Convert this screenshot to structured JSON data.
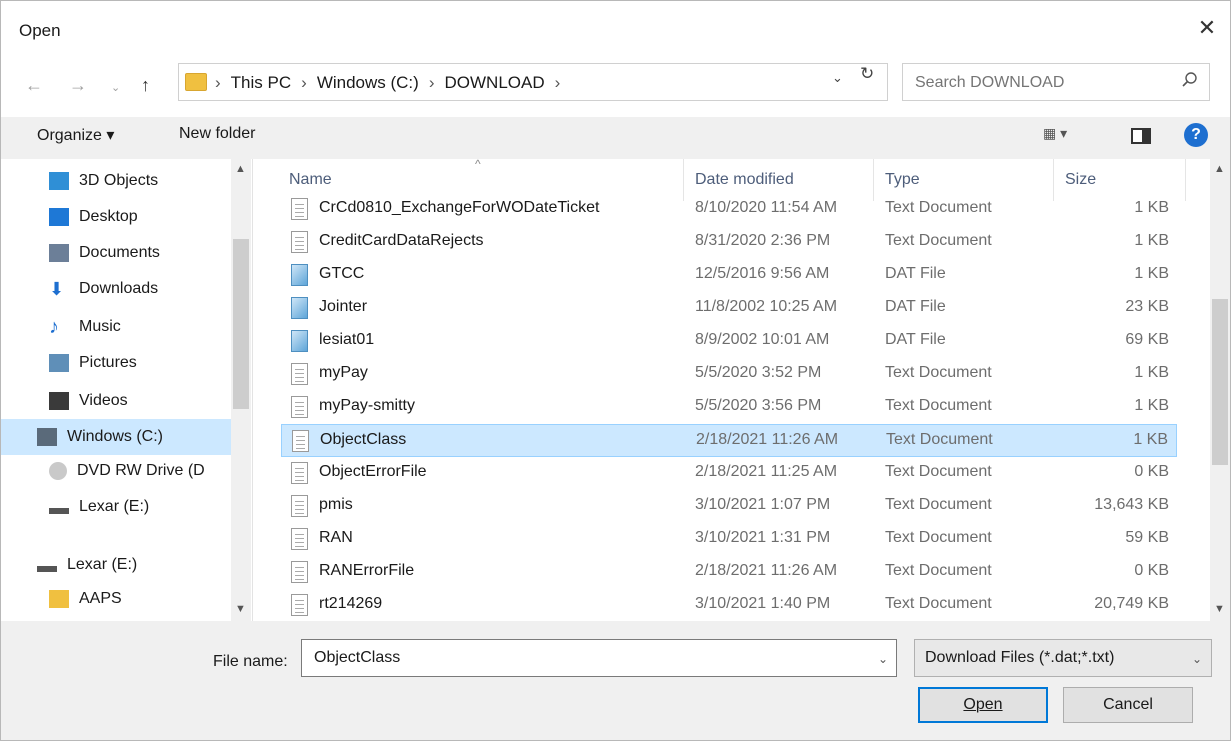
{
  "window": {
    "title": "Open",
    "close_icon": "close-icon"
  },
  "nav": {
    "back_icon": "back-arrow-icon",
    "forward_icon": "forward-arrow-icon",
    "recent_icon": "recent-locations-chevron-icon",
    "up_icon": "up-arrow-icon"
  },
  "address": {
    "breadcrumbs": [
      "This PC",
      "Windows (C:)",
      "DOWNLOAD"
    ],
    "separator": "›"
  },
  "search": {
    "placeholder": "Search DOWNLOAD"
  },
  "toolbar": {
    "organize_label": "Organize ▾",
    "new_folder_label": "New folder",
    "view_label": "▦ ▾",
    "help_label": "?"
  },
  "sidebar": {
    "items": [
      {
        "label": "3D Objects",
        "icon": "cube-3d-icon",
        "color": "#2f8fd6"
      },
      {
        "label": "Desktop",
        "icon": "desktop-icon",
        "color": "#1e78d6"
      },
      {
        "label": "Documents",
        "icon": "documents-icon",
        "color": "#6c7f98"
      },
      {
        "label": "Downloads",
        "icon": "download-arrow-icon",
        "color": "#1e6fd0"
      },
      {
        "label": "Music",
        "icon": "music-note-icon",
        "color": "#1e6fd0"
      },
      {
        "label": "Pictures",
        "icon": "pictures-icon",
        "color": "#5f8fb8"
      },
      {
        "label": "Videos",
        "icon": "videos-icon",
        "color": "#3a3a3a"
      },
      {
        "label": "Windows (C:)",
        "icon": "drive-icon",
        "color": "#5a6a7a",
        "selected": true
      },
      {
        "label": "DVD RW Drive (D",
        "icon": "dvd-drive-icon",
        "color": "#c9c9c9"
      },
      {
        "label": "Lexar (E:)",
        "icon": "usb-drive-icon",
        "color": "#555555"
      },
      {
        "label": "Lexar (E:)",
        "icon": "usb-drive-icon",
        "color": "#555555"
      },
      {
        "label": "AAPS",
        "icon": "folder-icon",
        "color": "#f0c040"
      }
    ]
  },
  "files": {
    "columns": [
      "Name",
      "Date modified",
      "Type",
      "Size"
    ],
    "rows": [
      {
        "name": "CrCd0810_ExchangeForWODateTicket",
        "date": "8/10/2020 11:54 AM",
        "type": "Text Document",
        "size": "1 KB",
        "kind": "txt"
      },
      {
        "name": "CreditCardDataRejects",
        "date": "8/31/2020 2:36 PM",
        "type": "Text Document",
        "size": "1 KB",
        "kind": "txt"
      },
      {
        "name": "GTCC",
        "date": "12/5/2016 9:56 AM",
        "type": "DAT File",
        "size": "1 KB",
        "kind": "dat"
      },
      {
        "name": "Jointer",
        "date": "11/8/2002 10:25 AM",
        "type": "DAT File",
        "size": "23 KB",
        "kind": "dat"
      },
      {
        "name": "lesiat01",
        "date": "8/9/2002 10:01 AM",
        "type": "DAT File",
        "size": "69 KB",
        "kind": "dat"
      },
      {
        "name": "myPay",
        "date": "5/5/2020 3:52 PM",
        "type": "Text Document",
        "size": "1 KB",
        "kind": "txt"
      },
      {
        "name": "myPay-smitty",
        "date": "5/5/2020 3:56 PM",
        "type": "Text Document",
        "size": "1 KB",
        "kind": "txt"
      },
      {
        "name": "ObjectClass",
        "date": "2/18/2021 11:26 AM",
        "type": "Text Document",
        "size": "1 KB",
        "kind": "txt",
        "selected": true
      },
      {
        "name": "ObjectErrorFile",
        "date": "2/18/2021 11:25 AM",
        "type": "Text Document",
        "size": "0 KB",
        "kind": "txt"
      },
      {
        "name": "pmis",
        "date": "3/10/2021 1:07 PM",
        "type": "Text Document",
        "size": "13,643 KB",
        "kind": "txt"
      },
      {
        "name": "RAN",
        "date": "3/10/2021 1:31 PM",
        "type": "Text Document",
        "size": "59 KB",
        "kind": "txt"
      },
      {
        "name": "RANErrorFile",
        "date": "2/18/2021 11:26 AM",
        "type": "Text Document",
        "size": "0 KB",
        "kind": "txt"
      },
      {
        "name": "rt214269",
        "date": "3/10/2021 1:40 PM",
        "type": "Text Document",
        "size": "20,749 KB",
        "kind": "txt"
      }
    ]
  },
  "bottom": {
    "filename_label": "File name:",
    "filename_value": "ObjectClass",
    "filter_value": "Download Files (*.dat;*.txt)",
    "open_label": "Open",
    "cancel_label": "Cancel"
  }
}
